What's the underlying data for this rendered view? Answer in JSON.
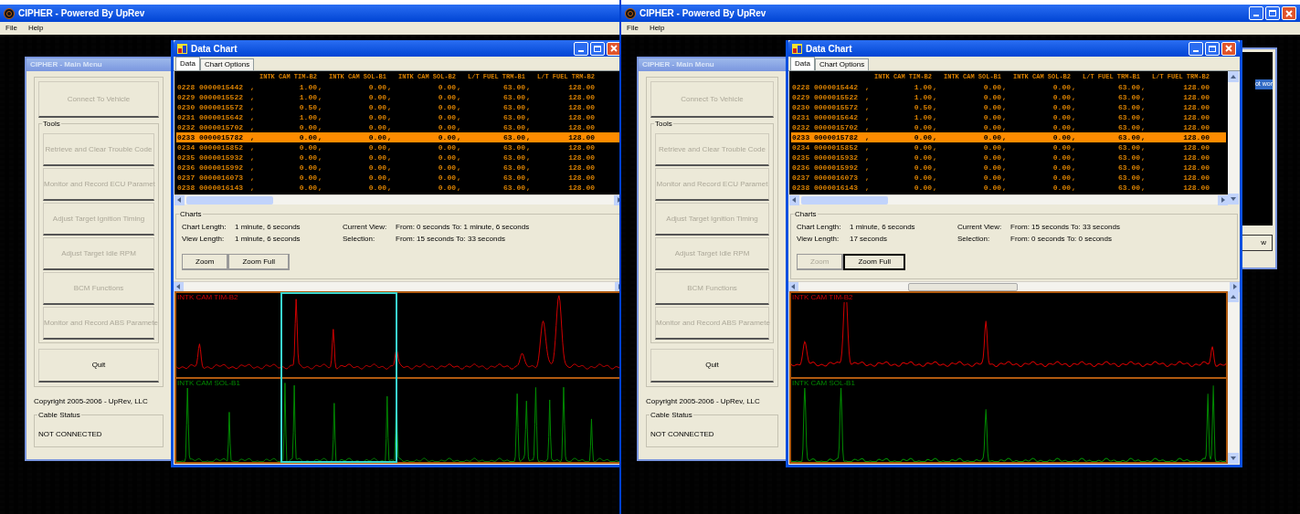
{
  "panels": [
    {
      "app_window": {
        "title": "CIPHER - Powered By UpRev",
        "window_buttons": false
      },
      "menu": [
        "File",
        "Help"
      ],
      "main_menu": {
        "title": "CIPHER - Main Menu",
        "connect_button": {
          "label": "Connect To Vehicle",
          "disabled": true
        },
        "tools_label": "Tools",
        "tools": [
          {
            "label": "Retrieve and Clear Trouble Code",
            "disabled": true
          },
          {
            "label": "Monitor and Record ECU Paramet",
            "disabled": true
          },
          {
            "label": "Adjust Target Ignition Timing",
            "disabled": true
          },
          {
            "label": "Adjust Target Idle RPM",
            "disabled": true
          },
          {
            "label": "BCM Functions",
            "disabled": true
          },
          {
            "label": "Monitor and Record ABS Paramete",
            "disabled": true
          }
        ],
        "quit_button": {
          "label": "Quit",
          "disabled": false
        },
        "copyright": "Copyright 2005-2006 - UpRev, LLC",
        "cable_status": {
          "label": "Cable Status",
          "value": "NOT CONNECTED"
        }
      },
      "data_chart": {
        "title": "Data Chart",
        "tabs": [
          {
            "label": "Data",
            "selected": true
          },
          {
            "label": "Chart Options",
            "selected": false
          }
        ],
        "table": {
          "columns": [
            "",
            "",
            "",
            "INTK CAM TIM-B2",
            "",
            "INTK CAM SOL-B1",
            "",
            "INTK CAM SOL-B2",
            "",
            "L/T FUEL TRM-B1",
            "",
            "L/T FUEL TRM-B2"
          ],
          "rows": [
            {
              "selected": false,
              "cells": [
                "0228",
                "0000015442",
                ",",
                "1.00",
                ",",
                "0.00",
                ",",
                "0.00",
                ",",
                "63.00",
                ",",
                "128.00"
              ]
            },
            {
              "selected": false,
              "cells": [
                "0229",
                "0000015522",
                ",",
                "1.00",
                ",",
                "0.00",
                ",",
                "0.00",
                ",",
                "63.00",
                ",",
                "128.00"
              ]
            },
            {
              "selected": false,
              "cells": [
                "0230",
                "0000015572",
                ",",
                "0.50",
                ",",
                "0.00",
                ",",
                "0.00",
                ",",
                "63.00",
                ",",
                "128.00"
              ]
            },
            {
              "selected": false,
              "cells": [
                "0231",
                "0000015642",
                ",",
                "1.00",
                ",",
                "0.00",
                ",",
                "0.00",
                ",",
                "63.00",
                ",",
                "128.00"
              ]
            },
            {
              "selected": false,
              "cells": [
                "0232",
                "0000015702",
                ",",
                "0.00",
                ",",
                "0.00",
                ",",
                "0.00",
                ",",
                "63.00",
                ",",
                "128.00"
              ]
            },
            {
              "selected": true,
              "cells": [
                "0233",
                "0000015782",
                ",",
                "0.00",
                ",",
                "0.00",
                ",",
                "0.00",
                ",",
                "63.00",
                ",",
                "128.00"
              ]
            },
            {
              "selected": false,
              "cells": [
                "0234",
                "0000015852",
                ",",
                "0.00",
                ",",
                "0.00",
                ",",
                "0.00",
                ",",
                "63.00",
                ",",
                "128.00"
              ]
            },
            {
              "selected": false,
              "cells": [
                "0235",
                "0000015932",
                ",",
                "0.00",
                ",",
                "0.00",
                ",",
                "0.00",
                ",",
                "63.00",
                ",",
                "128.00"
              ]
            },
            {
              "selected": false,
              "cells": [
                "0236",
                "0000015992",
                ",",
                "0.00",
                ",",
                "0.00",
                ",",
                "0.00",
                ",",
                "63.00",
                ",",
                "128.00"
              ]
            },
            {
              "selected": false,
              "cells": [
                "0237",
                "0000016073",
                ",",
                "0.00",
                ",",
                "0.00",
                ",",
                "0.00",
                ",",
                "63.00",
                ",",
                "128.00"
              ]
            },
            {
              "selected": false,
              "cells": [
                "0238",
                "0000016143",
                ",",
                "0.00",
                ",",
                "0.00",
                ",",
                "0.00",
                ",",
                "63.00",
                ",",
                "128.00"
              ]
            }
          ]
        },
        "charts_label": "Charts",
        "info": [
          {
            "label": "Chart Length:",
            "value": "1 minute, 6 seconds"
          },
          {
            "label": "Current View:",
            "value": "From: 0 seconds To: 1 minute, 6 seconds"
          },
          {
            "label": "View Length:",
            "value": "1 minute, 6 seconds"
          },
          {
            "label": "Selection:",
            "value": "From: 15 seconds To: 33 seconds"
          }
        ],
        "buttons": [
          {
            "label": "Zoom",
            "disabled": false,
            "focused": false
          },
          {
            "label": "Zoom Full",
            "disabled": false,
            "focused": false
          }
        ],
        "vertical_scrollbars": false,
        "selection_box": true,
        "strips": [
          {
            "label": "INTK CAM TIM-B2",
            "color": "#d00000"
          },
          {
            "label": "INTK CAM SOL-B1",
            "color": "#008a00"
          }
        ]
      }
    },
    {
      "app_window": {
        "title": "CIPHER - Powered By UpRev",
        "window_buttons": true
      },
      "menu": [
        "File",
        "Help"
      ],
      "main_menu": {
        "title": "CIPHER - Main Menu",
        "connect_button": {
          "label": "Connect To Vehicle",
          "disabled": true
        },
        "tools_label": "Tools",
        "tools": [
          {
            "label": "Retrieve and Clear Trouble Code",
            "disabled": true
          },
          {
            "label": "Monitor and Record ECU Paramet",
            "disabled": true
          },
          {
            "label": "Adjust Target Ignition Timing",
            "disabled": true
          },
          {
            "label": "Adjust Target Idle RPM",
            "disabled": true
          },
          {
            "label": "BCM Functions",
            "disabled": true
          },
          {
            "label": "Monitor and Record ABS Paramete",
            "disabled": true
          }
        ],
        "quit_button": {
          "label": "Quit",
          "disabled": false
        },
        "copyright": "Copyright 2005-2006 - UpRev, LLC",
        "cable_status": {
          "label": "Cable Status",
          "value": "NOT CONNECTED"
        }
      },
      "data_chart": {
        "title": "Data Chart",
        "tabs": [
          {
            "label": "Data",
            "selected": true
          },
          {
            "label": "Chart Options",
            "selected": false
          }
        ],
        "table": {
          "columns": [
            "",
            "",
            "",
            "INTK CAM TIM-B2",
            "",
            "INTK CAM SOL-B1",
            "",
            "INTK CAM SOL-B2",
            "",
            "L/T FUEL TRM-B1",
            "",
            "L/T FUEL TRM-B2"
          ],
          "rows": [
            {
              "selected": false,
              "cells": [
                "0228",
                "0000015442",
                ",",
                "1.00",
                ",",
                "0.00",
                ",",
                "0.00",
                ",",
                "63.00",
                ",",
                "128.00"
              ]
            },
            {
              "selected": false,
              "cells": [
                "0229",
                "0000015522",
                ",",
                "1.00",
                ",",
                "0.00",
                ",",
                "0.00",
                ",",
                "63.00",
                ",",
                "128.00"
              ]
            },
            {
              "selected": false,
              "cells": [
                "0230",
                "0000015572",
                ",",
                "0.50",
                ",",
                "0.00",
                ",",
                "0.00",
                ",",
                "63.00",
                ",",
                "128.00"
              ]
            },
            {
              "selected": false,
              "cells": [
                "0231",
                "0000015642",
                ",",
                "1.00",
                ",",
                "0.00",
                ",",
                "0.00",
                ",",
                "63.00",
                ",",
                "128.00"
              ]
            },
            {
              "selected": false,
              "cells": [
                "0232",
                "0000015702",
                ",",
                "0.00",
                ",",
                "0.00",
                ",",
                "0.00",
                ",",
                "63.00",
                ",",
                "128.00"
              ]
            },
            {
              "selected": true,
              "cells": [
                "0233",
                "0000015782",
                ",",
                "0.00",
                ",",
                "0.00",
                ",",
                "0.00",
                ",",
                "63.00",
                ",",
                "128.00"
              ]
            },
            {
              "selected": false,
              "cells": [
                "0234",
                "0000015852",
                ",",
                "0.00",
                ",",
                "0.00",
                ",",
                "0.00",
                ",",
                "63.00",
                ",",
                "128.00"
              ]
            },
            {
              "selected": false,
              "cells": [
                "0235",
                "0000015932",
                ",",
                "0.00",
                ",",
                "0.00",
                ",",
                "0.00",
                ",",
                "63.00",
                ",",
                "128.00"
              ]
            },
            {
              "selected": false,
              "cells": [
                "0236",
                "0000015992",
                ",",
                "0.00",
                ",",
                "0.00",
                ",",
                "0.00",
                ",",
                "63.00",
                ",",
                "128.00"
              ]
            },
            {
              "selected": false,
              "cells": [
                "0237",
                "0000016073",
                ",",
                "0.00",
                ",",
                "0.00",
                ",",
                "0.00",
                ",",
                "63.00",
                ",",
                "128.00"
              ]
            },
            {
              "selected": false,
              "cells": [
                "0238",
                "0000016143",
                ",",
                "0.00",
                ",",
                "0.00",
                ",",
                "0.00",
                ",",
                "63.00",
                ",",
                "128.00"
              ]
            }
          ]
        },
        "charts_label": "Charts",
        "info": [
          {
            "label": "Chart Length:",
            "value": "1 minute, 6 seconds"
          },
          {
            "label": "Current View:",
            "value": "From: 15 seconds To: 33 seconds"
          },
          {
            "label": "View Length:",
            "value": "17 seconds"
          },
          {
            "label": "Selection:",
            "value": "From: 0 seconds To: 0 seconds"
          }
        ],
        "buttons": [
          {
            "label": "Zoom",
            "disabled": true,
            "focused": false
          },
          {
            "label": "Zoom Full",
            "disabled": false,
            "focused": true
          }
        ],
        "vertical_scrollbars": true,
        "selection_box": false,
        "strips": [
          {
            "label": "INTK CAM TIM-B2",
            "color": "#d00000"
          },
          {
            "label": "INTK CAM SOL-B1",
            "color": "#008a00"
          }
        ]
      },
      "back_window": {
        "text": "ot wor",
        "button": "w"
      }
    }
  ]
}
